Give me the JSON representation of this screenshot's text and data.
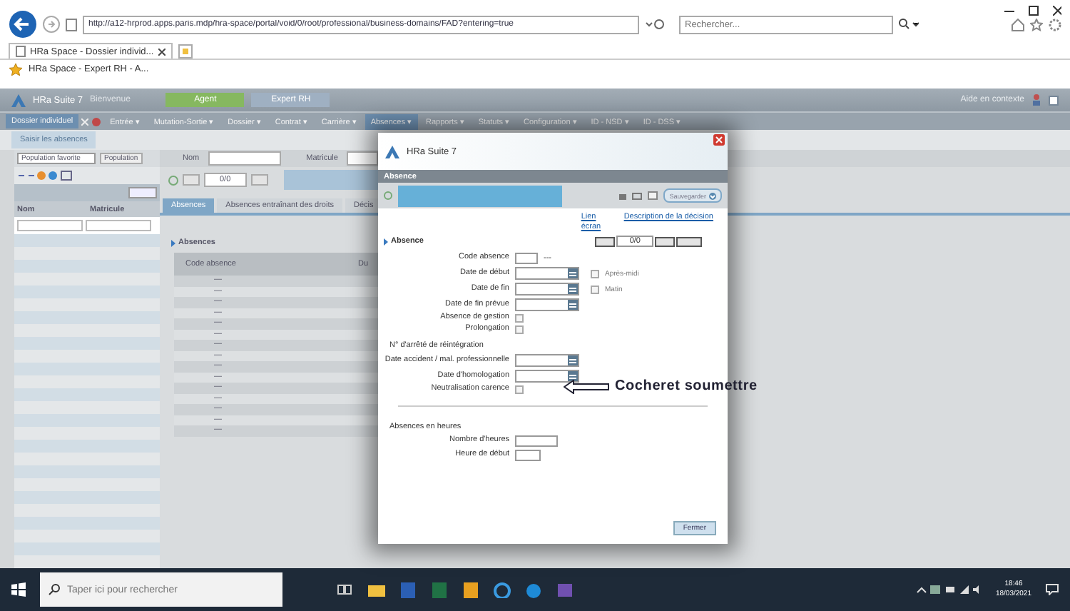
{
  "browser": {
    "address": "http://a12-hrprod.apps.paris.mdp/hra-space/portal/void/0/root/professional/business-domains/FAD?entering=true",
    "search_placeholder": "Rechercher...",
    "tabs": [
      {
        "label": "HRa Space - Dossier individ...",
        "selected": true
      }
    ],
    "favorites": [
      "HRa Space - Expert RH - A..."
    ]
  },
  "app": {
    "title": "HRa Suite 7",
    "welcome": "Bienvenue",
    "help": "Aide en contexte",
    "roles": [
      {
        "label": "Agent",
        "selected": true
      },
      {
        "label": "Expert RH",
        "selected": false
      }
    ],
    "menu": [
      {
        "label": "Dossier individuel",
        "selected": true
      },
      {
        "label": "Entrée ▾",
        "selected": false
      },
      {
        "label": "Mutation-Sortie ▾",
        "selected": false
      },
      {
        "label": "Dossier ▾",
        "selected": false
      },
      {
        "label": "Contrat ▾",
        "selected": false
      },
      {
        "label": "Carrière ▾",
        "selected": false
      },
      {
        "label": "Absences ▾",
        "selected": true
      },
      {
        "label": "Rapports ▾",
        "selected": false
      },
      {
        "label": "Statuts ▾",
        "selected": false
      },
      {
        "label": "Configuration ▾",
        "selected": false
      },
      {
        "label": "ID - NSD ▾",
        "selected": false
      },
      {
        "label": "ID - DSS ▾",
        "selected": false
      }
    ],
    "subtitle": "Saisir les absences"
  },
  "left_panel": {
    "population_select": "Population favorite",
    "population_button": "Population",
    "columns": [
      "Nom",
      "Matricule"
    ]
  },
  "main": {
    "search_labels": [
      "Nom",
      "Matricule"
    ],
    "pager": "0/0",
    "tabs": [
      {
        "label": "Absences",
        "selected": true
      },
      {
        "label": "Absences entraînant des droits",
        "selected": false
      },
      {
        "label": "Décis",
        "selected": false
      }
    ],
    "section": "Absences",
    "columns": [
      "Code absence",
      "Du"
    ],
    "rows": [
      "—",
      "—",
      "—",
      "—",
      "—",
      "—",
      "—",
      "—",
      "—",
      "—",
      "—",
      "—",
      "—",
      "—",
      "—"
    ]
  },
  "dialog": {
    "title": "HRa Suite 7",
    "header": "Absence",
    "action_select": "Sauvegarder",
    "link_screen": "Lien écran",
    "link_description": "Description de la décision",
    "section": "Absence",
    "pager": "0/0",
    "fields": [
      {
        "kind": "code",
        "label": "Code absence",
        "suffix": "---"
      },
      {
        "kind": "date",
        "label": "Date de début",
        "option": {
          "label": "Après-midi",
          "checked": false
        }
      },
      {
        "kind": "date",
        "label": "Date de fin",
        "option": {
          "label": "Matin",
          "checked": false
        }
      },
      {
        "kind": "date",
        "label": "Date de fin prévue"
      },
      {
        "kind": "checkbox",
        "label": "Absence de gestion",
        "checked": false
      },
      {
        "kind": "checkbox",
        "label": "Prolongation",
        "checked": false
      },
      {
        "kind": "heading",
        "label": "N° d'arrêté de réintégration"
      },
      {
        "kind": "date",
        "label": "Date accident / mal. professionnelle"
      },
      {
        "kind": "date",
        "label": "Date d'homologation"
      },
      {
        "kind": "checkbox",
        "label": "Neutralisation carence",
        "checked": false,
        "annotation": "Cocheret soumettre"
      },
      {
        "kind": "rule"
      },
      {
        "kind": "heading",
        "label": "Absences en heures"
      },
      {
        "kind": "text",
        "label": "Nombre d'heures"
      },
      {
        "kind": "short",
        "label": "Heure de début"
      }
    ],
    "close_button": "Fermer"
  },
  "taskbar": {
    "search_placeholder": "Taper ici pour rechercher",
    "time": "18:46",
    "date": "18/03/2021"
  }
}
